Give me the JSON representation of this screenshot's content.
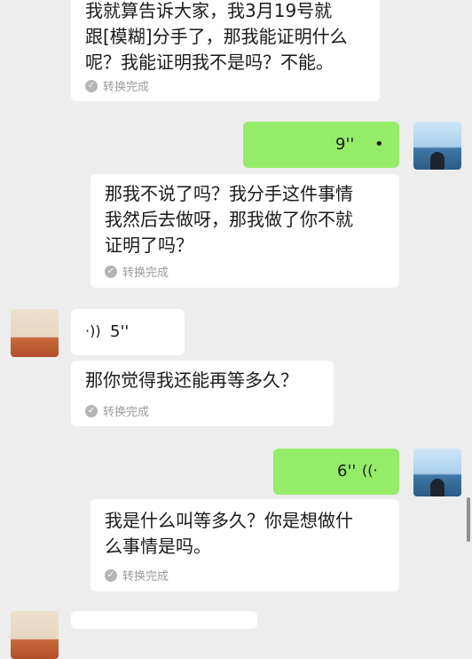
{
  "messages": [
    {
      "side": "left",
      "lines": [
        "我就算告诉大家，我3月19号就",
        "跟[模糊]分手了，那我能证明什么",
        "呢？我能证明我不是吗？不能。"
      ],
      "status": "转换完成"
    },
    {
      "side": "right",
      "type": "voice",
      "duration": "9''"
    },
    {
      "side": "left",
      "lines": [
        "那我不说了吗？我分手这件事情",
        "我然后去做呀，那我做了你不就",
        "证明了吗？"
      ],
      "status": "转换完成"
    },
    {
      "side": "left",
      "type": "voice",
      "duration": "5''"
    },
    {
      "side": "left",
      "lines": [
        "那你觉得我还能再等多久？"
      ],
      "status": "转换完成"
    },
    {
      "side": "right",
      "type": "voice",
      "duration": "6''"
    },
    {
      "side": "left",
      "lines": [
        "我是什么叫等多久？你是想做什",
        "么事情是吗。"
      ],
      "status": "转换完成"
    }
  ],
  "icons": {
    "check": "✓",
    "voice_right": "•",
    "voice_left": "·))",
    "voice_right_playing": "((·"
  }
}
